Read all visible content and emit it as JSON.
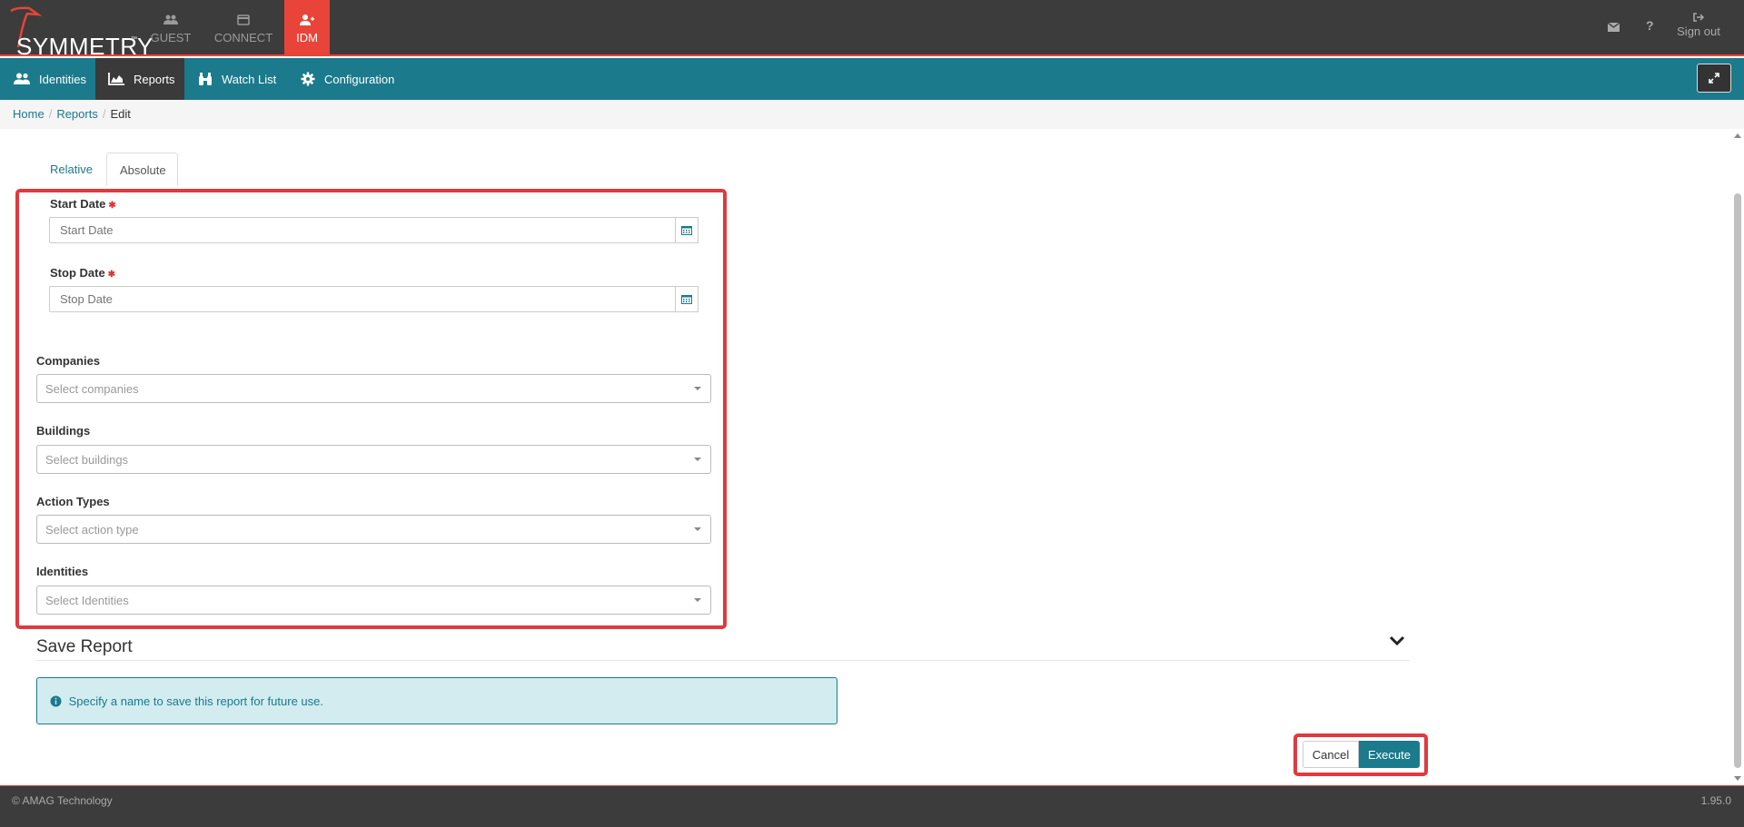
{
  "app": {
    "logo_text": "SYMMETRY",
    "logo_tm": "™",
    "brand_color": "#e8443a",
    "accent_color": "#1b7a8c"
  },
  "modules": [
    {
      "label": "GUEST",
      "icon": "users-icon"
    },
    {
      "label": "CONNECT",
      "icon": "card-icon"
    },
    {
      "label": "IDM",
      "icon": "user-plus-icon",
      "active": true
    }
  ],
  "header_right": {
    "mail_icon": "envelope-icon",
    "help_label": "?",
    "signout_label": "Sign out"
  },
  "nav": {
    "items": [
      {
        "label": "Identities",
        "icon": "users-icon"
      },
      {
        "label": "Reports",
        "icon": "area-chart-icon",
        "active": true
      },
      {
        "label": "Watch List",
        "icon": "binoculars-icon"
      },
      {
        "label": "Configuration",
        "icon": "gear-icon"
      }
    ],
    "expand_icon": "expand-icon"
  },
  "breadcrumb": {
    "items": [
      "Home",
      "Reports",
      "Edit"
    ],
    "separator": "/"
  },
  "tabs": [
    {
      "label": "Relative"
    },
    {
      "label": "Absolute",
      "active": true
    }
  ],
  "form": {
    "start_date": {
      "label": "Start Date",
      "placeholder": "Start Date",
      "required_mark": "✱"
    },
    "stop_date": {
      "label": "Stop Date",
      "placeholder": "Stop Date",
      "required_mark": "✱"
    },
    "companies": {
      "label": "Companies",
      "placeholder": "Select companies"
    },
    "buildings": {
      "label": "Buildings",
      "placeholder": "Select buildings"
    },
    "action_types": {
      "label": "Action Types",
      "placeholder": "Select action type"
    },
    "identities": {
      "label": "Identities",
      "placeholder": "Select Identities"
    }
  },
  "save_report": {
    "title": "Save Report",
    "info_text": "Specify a name to save this report for future use."
  },
  "actions": {
    "cancel_label": "Cancel",
    "execute_label": "Execute"
  },
  "footer": {
    "copyright": "© AMAG Technology",
    "version": "1.95.0"
  }
}
